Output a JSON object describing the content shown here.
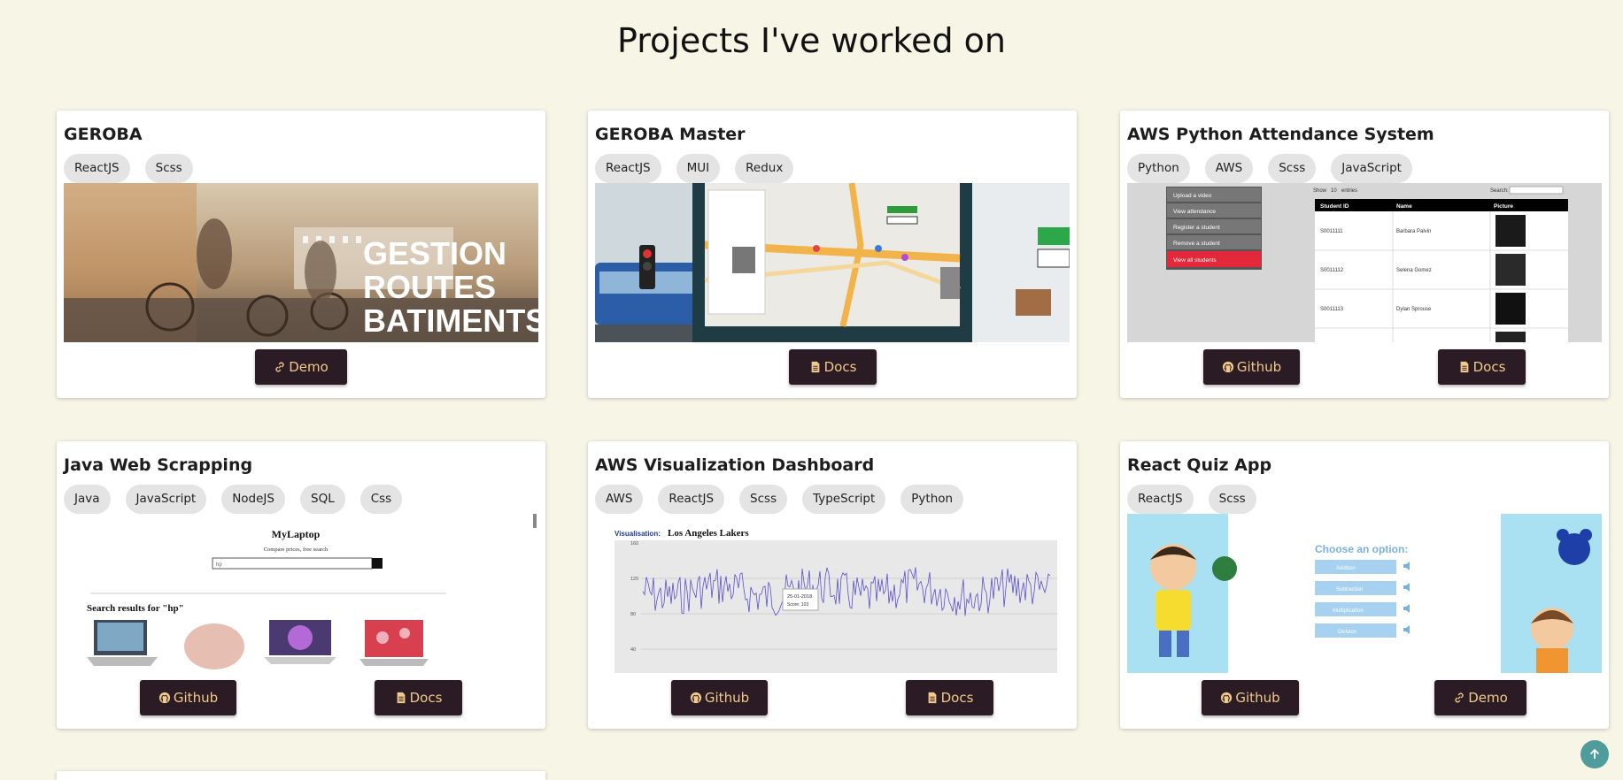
{
  "page": {
    "title": "Projects I've worked on"
  },
  "projects": [
    {
      "title": "GEROBA",
      "tags": [
        "ReactJS",
        "Scss"
      ],
      "thumb_text": [
        "GESTION",
        "ROUTES",
        "BATIMENTS"
      ],
      "buttons": [
        {
          "label": "Demo",
          "icon": "link-icon"
        }
      ]
    },
    {
      "title": "GEROBA Master",
      "tags": [
        "ReactJS",
        "MUI",
        "Redux"
      ],
      "buttons": [
        {
          "label": "Docs",
          "icon": "document-icon"
        }
      ]
    },
    {
      "title": "AWS Python Attendance System",
      "tags": [
        "Python",
        "AWS",
        "Scss",
        "JavaScript"
      ],
      "thumb_menu": [
        "Upload a video",
        "View attendance",
        "Register a student",
        "Remove a student",
        "View all students"
      ],
      "thumb_table": {
        "show_label": "Show",
        "show_value": "10",
        "entries_label": "entries",
        "search_label": "Search:",
        "headers": [
          "Student ID",
          "Name",
          "Picture"
        ],
        "rows": [
          [
            "S0011111",
            "Barbara Palvin"
          ],
          [
            "S0011112",
            "Selena Gomez"
          ],
          [
            "S0011113",
            "Dylan Sprouse"
          ]
        ]
      },
      "buttons": [
        {
          "label": "Github",
          "icon": "github-icon"
        },
        {
          "label": "Docs",
          "icon": "document-icon"
        }
      ]
    },
    {
      "title": "Java Web Scrapping",
      "tags": [
        "Java",
        "JavaScript",
        "NodeJS",
        "SQL",
        "Css"
      ],
      "thumb_site": {
        "brand": "MyLaptop",
        "tagline": "Compare prices, free search",
        "search_value": "hp",
        "results_label": "Search results for \"hp\""
      },
      "buttons": [
        {
          "label": "Github",
          "icon": "github-icon"
        },
        {
          "label": "Docs",
          "icon": "document-icon"
        }
      ]
    },
    {
      "title": "AWS Visualization Dashboard",
      "tags": [
        "AWS",
        "ReactJS",
        "Scss",
        "TypeScript",
        "Python"
      ],
      "thumb_chart": {
        "label": "Visualisation:",
        "team": "Los Angeles Lakers",
        "yticks": [
          "160",
          "120",
          "80",
          "40"
        ],
        "tooltip_date": "25-01-2018",
        "tooltip_value": "Score: 103"
      },
      "buttons": [
        {
          "label": "Github",
          "icon": "github-icon"
        },
        {
          "label": "Docs",
          "icon": "document-icon"
        }
      ]
    },
    {
      "title": "React Quiz App",
      "tags": [
        "ReactJS",
        "Scss"
      ],
      "thumb_quiz": {
        "heading": "Choose an option:",
        "options": [
          "Addition",
          "Subtraction",
          "Multiplication",
          "Division"
        ]
      },
      "buttons": [
        {
          "label": "Github",
          "icon": "github-icon"
        },
        {
          "label": "Demo",
          "icon": "link-icon"
        }
      ]
    }
  ],
  "colors": {
    "background": "#f6f5e6",
    "button_bg": "#2b1b24",
    "button_text": "#f1c98a",
    "scroll_top": "#4f9c9d"
  }
}
